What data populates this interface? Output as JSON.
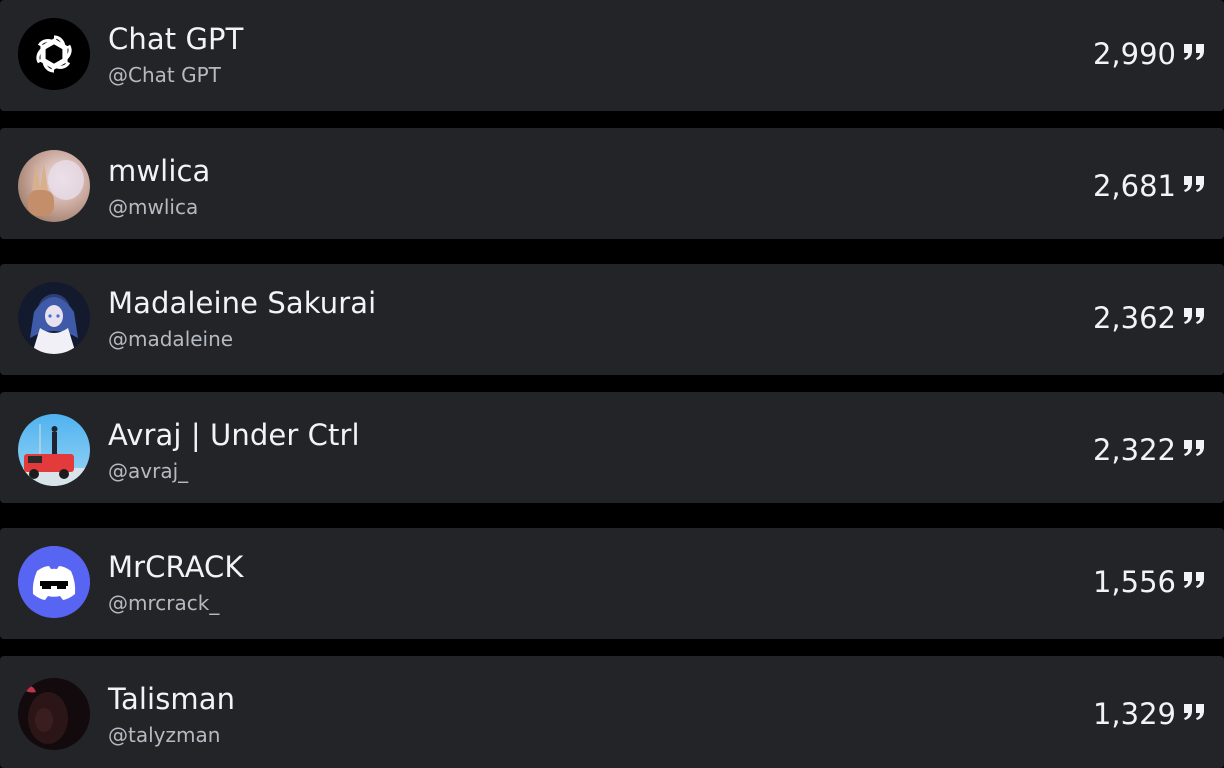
{
  "leaderboard": {
    "colors": {
      "row_bg": "#232428",
      "page_bg": "#000000",
      "name_text": "#f2f3f5",
      "handle_text": "#b5bac1",
      "discord_blurple": "#5865f2"
    },
    "entries": [
      {
        "name": "Chat GPT",
        "handle": "@Chat GPT",
        "count": "2,990",
        "avatar_icon": "openai-logo-icon"
      },
      {
        "name": "mwlica",
        "handle": "@mwlica",
        "count": "2,681",
        "avatar_icon": "photo-avatar"
      },
      {
        "name": "Madaleine Sakurai",
        "handle": "@madaleine",
        "count": "2,362",
        "avatar_icon": "anime-avatar"
      },
      {
        "name": "Avraj | Under Ctrl",
        "handle": "@avraj_",
        "count": "2,322",
        "avatar_icon": "car-photo-avatar"
      },
      {
        "name": "MrCRACK",
        "handle": "@mrcrack_",
        "count": "1,556",
        "avatar_icon": "discord-logo-icon"
      },
      {
        "name": "Talisman",
        "handle": "@talyzman",
        "count": "1,329",
        "avatar_icon": "dark-photo-avatar"
      }
    ],
    "count_icon": "quote-icon"
  }
}
